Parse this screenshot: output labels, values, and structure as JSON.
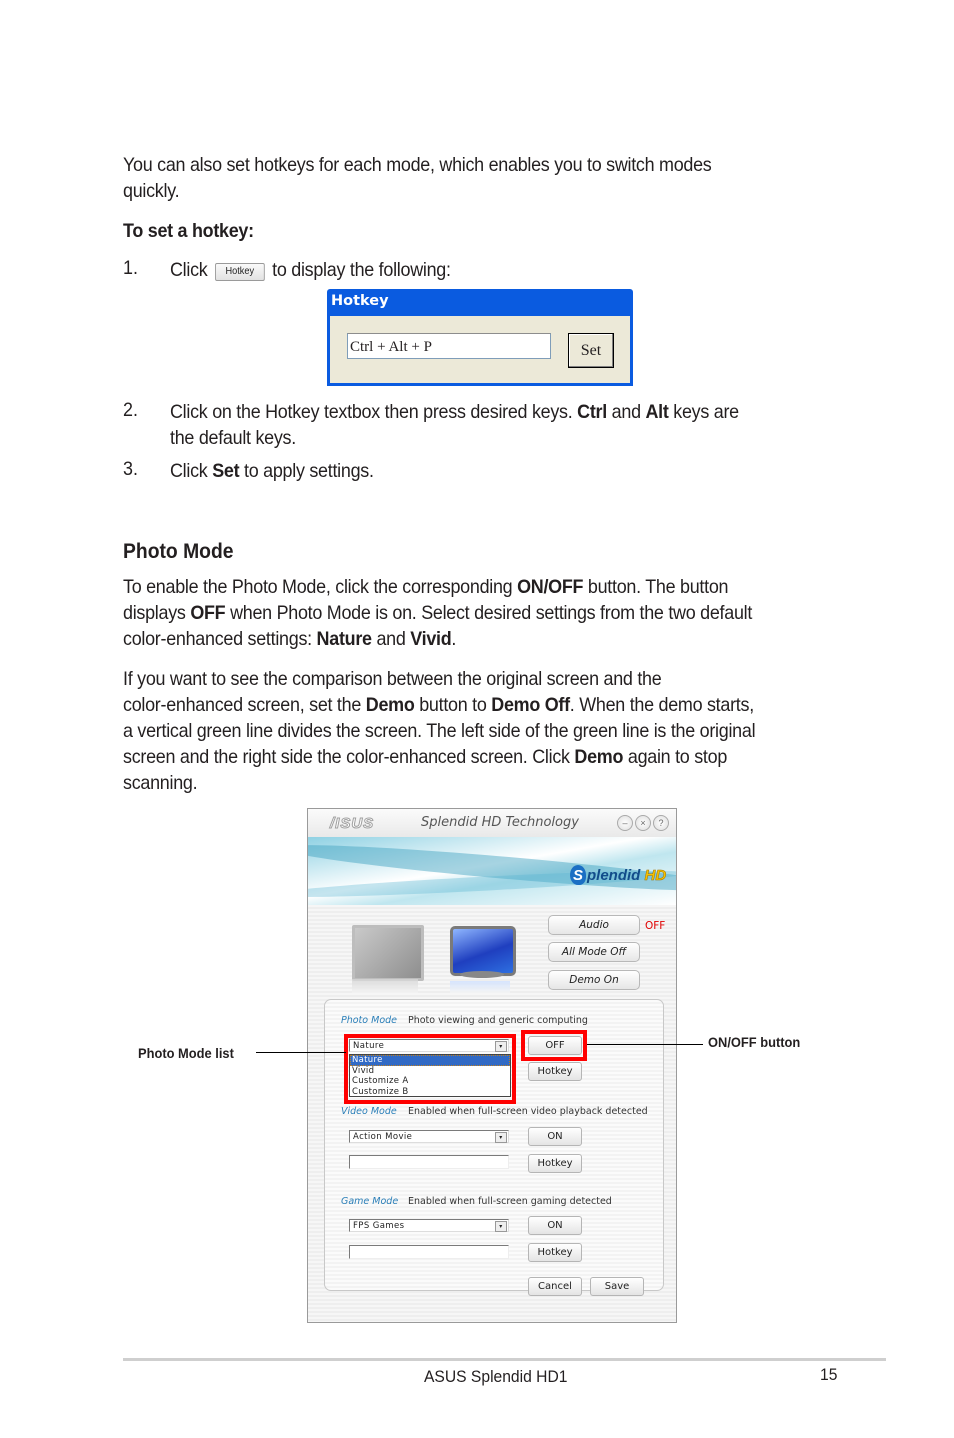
{
  "intro": {
    "paragraph": "You can also set hotkeys for each mode, which enables you to switch modes",
    "paragraph_cont": "quickly.",
    "heading": "To set a hotkey:"
  },
  "steps": [
    {
      "number": "1.",
      "pre": "Click",
      "inline_button": "Hotkey",
      "post": "to display the following:"
    },
    {
      "number": "2.",
      "line1_pre": "Click on the Hotkey textbox then press desired keys. ",
      "bold1": "Ctrl",
      "mid": " and ",
      "bold2": "Alt",
      "line1_post": " keys are",
      "line2": "the default keys."
    },
    {
      "number": "3.",
      "pre": "Click ",
      "bold": "Set",
      "post": " to apply settings."
    }
  ],
  "hotkey_dialog": {
    "title": "Hotkey",
    "textbox_value": "Ctrl + Alt + P",
    "set_button": "Set"
  },
  "photo_mode_section": {
    "heading": "Photo Mode",
    "p1": {
      "l1_a": "To enable the Photo Mode, click the corresponding ",
      "l1_b": "ON/OFF",
      "l1_c": " button. The button",
      "l2_a": "displays ",
      "l2_b": "OFF",
      "l2_c": " when Photo Mode is on. Select desired settings from the two default",
      "l3_a": "color-enhanced settings: ",
      "l3_b": "Nature",
      "l3_c": " and ",
      "l3_d": "Vivid",
      "l3_e": "."
    },
    "p2": {
      "l1": "If you want to see the comparison between the original screen and the",
      "l2_a": "color-enhanced screen, set the ",
      "l2_b": "Demo",
      "l2_c": " button to ",
      "l2_d": "Demo Off",
      "l2_e": ". When the demo starts,",
      "l3": "a vertical green line divides the screen. The left side of the green line is the original",
      "l4_a": "screen and the right side the color-enhanced screen. Click ",
      "l4_b": "Demo",
      "l4_c": " again to stop",
      "l5": "scanning."
    }
  },
  "app": {
    "logo": "/ISUS",
    "title": "Splendid HD Technology",
    "window_buttons": [
      "–",
      "×",
      "?"
    ],
    "brand_s": "S",
    "brand_text": "plendid ",
    "brand_hd": "HD",
    "audio_button": "Audio",
    "audio_status": "OFF",
    "all_mode_off_button": "All Mode Off",
    "demo_button": "Demo On",
    "photo_mode": {
      "title": "Photo Mode",
      "description": "Photo viewing and generic computing",
      "selected": "Nature",
      "options": [
        "Nature",
        "Vivid",
        "Customize A",
        "Customize B"
      ],
      "toggle": "OFF",
      "hotkey": "Hotkey"
    },
    "video_mode": {
      "title": "Video  Mode",
      "description": "Enabled when full-screen video playback detected",
      "selected": "Action Movie",
      "toggle": "ON",
      "hotkey_value": "",
      "hotkey": "Hotkey"
    },
    "game_mode": {
      "title": "Game Mode",
      "description": "Enabled when full-screen gaming detected",
      "selected": "FPS Games",
      "toggle": "ON",
      "hotkey_value": "",
      "hotkey": "Hotkey"
    },
    "cancel_button": "Cancel",
    "save_button": "Save",
    "dropdown_arrow": "▾"
  },
  "callouts": {
    "left": "Photo Mode list",
    "right": "ON/OFF button"
  },
  "footer": {
    "title": "ASUS Splendid HD1",
    "page": "15"
  },
  "colors": {
    "highlight_red": "#ff0000",
    "dialog_blue": "#0a5be0",
    "status_off_red": "#e00000",
    "selection_blue": "#316ac5"
  }
}
